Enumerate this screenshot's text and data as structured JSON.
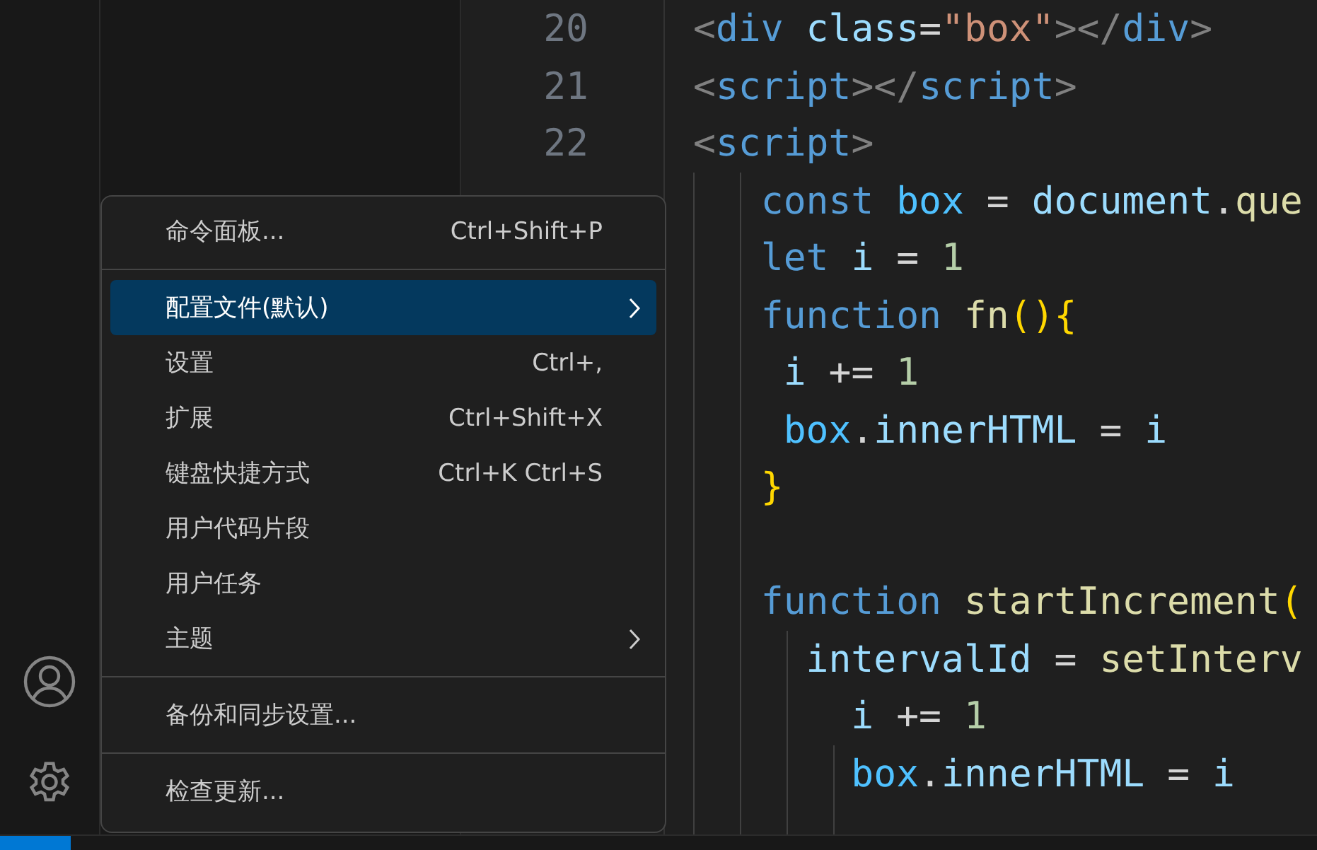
{
  "activity_bar": {
    "items": [
      {
        "kind": "account"
      },
      {
        "kind": "settings"
      }
    ]
  },
  "editor": {
    "line_numbers": [
      "20",
      "21",
      "22"
    ],
    "lines": [
      {
        "tokens": [
          {
            "text": "<",
            "color": "#808080"
          },
          {
            "text": "div",
            "color": "#569cd6"
          },
          {
            "text": " class",
            "color": "#9cdcfe"
          },
          {
            "text": "=",
            "color": "#d4d4d4"
          },
          {
            "text": "\"box\"",
            "color": "#ce9178"
          },
          {
            "text": "></",
            "color": "#808080"
          },
          {
            "text": "div",
            "color": "#569cd6"
          },
          {
            "text": ">",
            "color": "#808080"
          }
        ]
      },
      {
        "tokens": [
          {
            "text": "<",
            "color": "#808080"
          },
          {
            "text": "script",
            "color": "#569cd6"
          },
          {
            "text": "></",
            "color": "#808080"
          },
          {
            "text": "script",
            "color": "#569cd6"
          },
          {
            "text": ">",
            "color": "#808080"
          }
        ]
      },
      {
        "tokens": [
          {
            "text": "<",
            "color": "#808080"
          },
          {
            "text": "script",
            "color": "#569cd6"
          },
          {
            "text": ">",
            "color": "#808080"
          }
        ]
      },
      {
        "tokens": [
          {
            "text": "   const",
            "color": "#569cd6"
          },
          {
            "text": " box",
            "color": "#4fc1ff"
          },
          {
            "text": " = ",
            "color": "#d4d4d4"
          },
          {
            "text": "document",
            "color": "#9cdcfe"
          },
          {
            "text": ".",
            "color": "#d4d4d4"
          },
          {
            "text": "que",
            "color": "#dcdcaa"
          }
        ]
      },
      {
        "tokens": [
          {
            "text": "   let",
            "color": "#569cd6"
          },
          {
            "text": " i",
            "color": "#9cdcfe"
          },
          {
            "text": " = ",
            "color": "#d4d4d4"
          },
          {
            "text": "1",
            "color": "#b5cea8"
          }
        ]
      },
      {
        "tokens": [
          {
            "text": "   function",
            "color": "#569cd6"
          },
          {
            "text": " fn",
            "color": "#dcdcaa"
          },
          {
            "text": "(){",
            "color": "#ffd700"
          }
        ]
      },
      {
        "tokens": [
          {
            "text": "    i",
            "color": "#9cdcfe"
          },
          {
            "text": " += ",
            "color": "#d4d4d4"
          },
          {
            "text": "1",
            "color": "#b5cea8"
          }
        ]
      },
      {
        "tokens": [
          {
            "text": "    box",
            "color": "#4fc1ff"
          },
          {
            "text": ".",
            "color": "#d4d4d4"
          },
          {
            "text": "innerHTML",
            "color": "#9cdcfe"
          },
          {
            "text": " = ",
            "color": "#d4d4d4"
          },
          {
            "text": "i",
            "color": "#9cdcfe"
          }
        ]
      },
      {
        "tokens": [
          {
            "text": "   }",
            "color": "#ffd700"
          }
        ]
      },
      {
        "blank_before": true,
        "tokens": [
          {
            "text": "   function",
            "color": "#569cd6"
          },
          {
            "text": " startIncrement",
            "color": "#dcdcaa"
          },
          {
            "text": "(",
            "color": "#ffd700"
          }
        ]
      },
      {
        "tokens": [
          {
            "text": "     intervalId",
            "color": "#9cdcfe"
          },
          {
            "text": " = ",
            "color": "#d4d4d4"
          },
          {
            "text": "setInterv",
            "color": "#dcdcaa"
          }
        ]
      },
      {
        "tokens": [
          {
            "text": "       i",
            "color": "#9cdcfe"
          },
          {
            "text": " += ",
            "color": "#d4d4d4"
          },
          {
            "text": "1",
            "color": "#b5cea8"
          }
        ]
      },
      {
        "tokens": [
          {
            "text": "       box",
            "color": "#4fc1ff"
          },
          {
            "text": ".",
            "color": "#d4d4d4"
          },
          {
            "text": "innerHTML",
            "color": "#9cdcfe"
          },
          {
            "text": " = ",
            "color": "#d4d4d4"
          },
          {
            "text": "i",
            "color": "#9cdcfe"
          }
        ]
      }
    ]
  },
  "menu": {
    "items": [
      {
        "kind": "item",
        "label": "命令面板...",
        "shortcut": "Ctrl+Shift+P",
        "selected": false,
        "submenu": false
      },
      {
        "kind": "separator"
      },
      {
        "kind": "item",
        "label": "配置文件(默认)",
        "selected": true,
        "submenu": true
      },
      {
        "kind": "item",
        "label": "设置",
        "shortcut": "Ctrl+,",
        "selected": false,
        "submenu": false
      },
      {
        "kind": "item",
        "label": "扩展",
        "shortcut": "Ctrl+Shift+X",
        "selected": false,
        "submenu": false
      },
      {
        "kind": "item",
        "label": "键盘快捷方式",
        "shortcut": "Ctrl+K Ctrl+S",
        "selected": false,
        "submenu": false
      },
      {
        "kind": "item",
        "label": "用户代码片段",
        "selected": false,
        "submenu": false
      },
      {
        "kind": "item",
        "label": "用户任务",
        "selected": false,
        "submenu": false
      },
      {
        "kind": "item",
        "label": "主题",
        "selected": false,
        "submenu": true
      },
      {
        "kind": "separator"
      },
      {
        "kind": "item",
        "label": "备份和同步设置...",
        "selected": false,
        "submenu": false
      },
      {
        "kind": "separator"
      },
      {
        "kind": "item",
        "label": "检查更新...",
        "selected": false,
        "submenu": false
      }
    ]
  }
}
